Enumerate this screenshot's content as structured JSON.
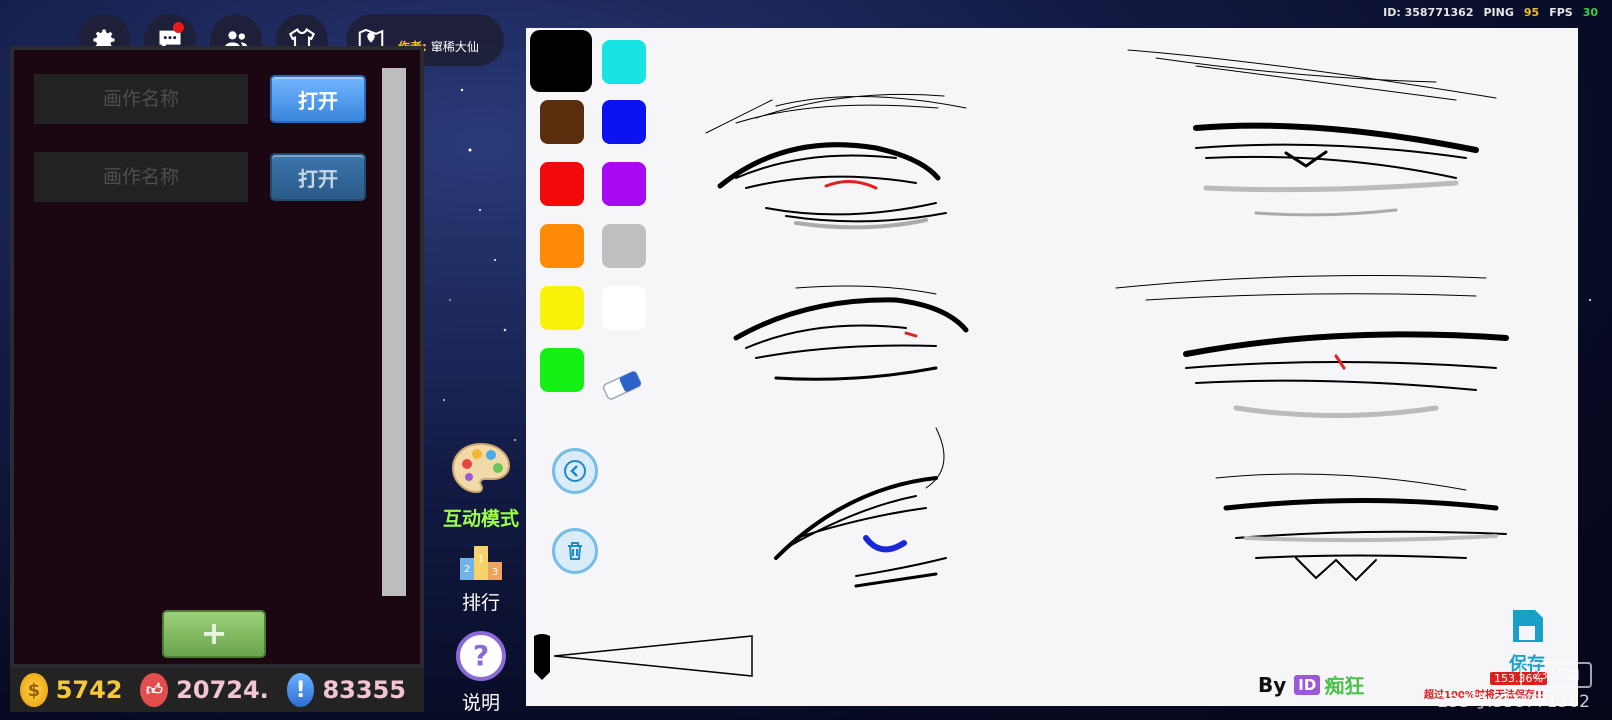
{
  "net_stats": {
    "id_text": "ID: 358771362",
    "ping_label": "PING",
    "ping_value": "95",
    "fps_label": "FPS",
    "fps_value": "30"
  },
  "author": {
    "label": "作者:",
    "name": "窜稀大仙"
  },
  "top_icons": [
    "gear-icon",
    "chat-icon",
    "friends-icon",
    "outfit-icon",
    "map-pin-icon"
  ],
  "panel": {
    "rows": [
      {
        "placeholder": "画作名称",
        "button": "打开"
      },
      {
        "placeholder": "画作名称",
        "button": "打开"
      }
    ],
    "add_label": "+"
  },
  "stats": {
    "coins": "5742",
    "likes": "20724.",
    "points": "83355"
  },
  "middle": {
    "interactive_label": "互动模式",
    "rank_label": "排行",
    "help_label": "说明"
  },
  "palette": [
    "#000000",
    "#17e3e3",
    "#5a2e0c",
    "#0b12f0",
    "#f20a0a",
    "#a70af0",
    "#ff8a05",
    "#bfbfbf",
    "#f9f30a",
    "#ffffff",
    "#14f014"
  ],
  "canvas": {
    "by_text": "By",
    "id_badge": "ID",
    "creator": "痴狂",
    "save_label": "保存",
    "percent": "153.36%",
    "warning": "超过100%时将无法保存!!"
  },
  "watermark": {
    "logo": "233乐园",
    "text": "233号:358771362"
  }
}
